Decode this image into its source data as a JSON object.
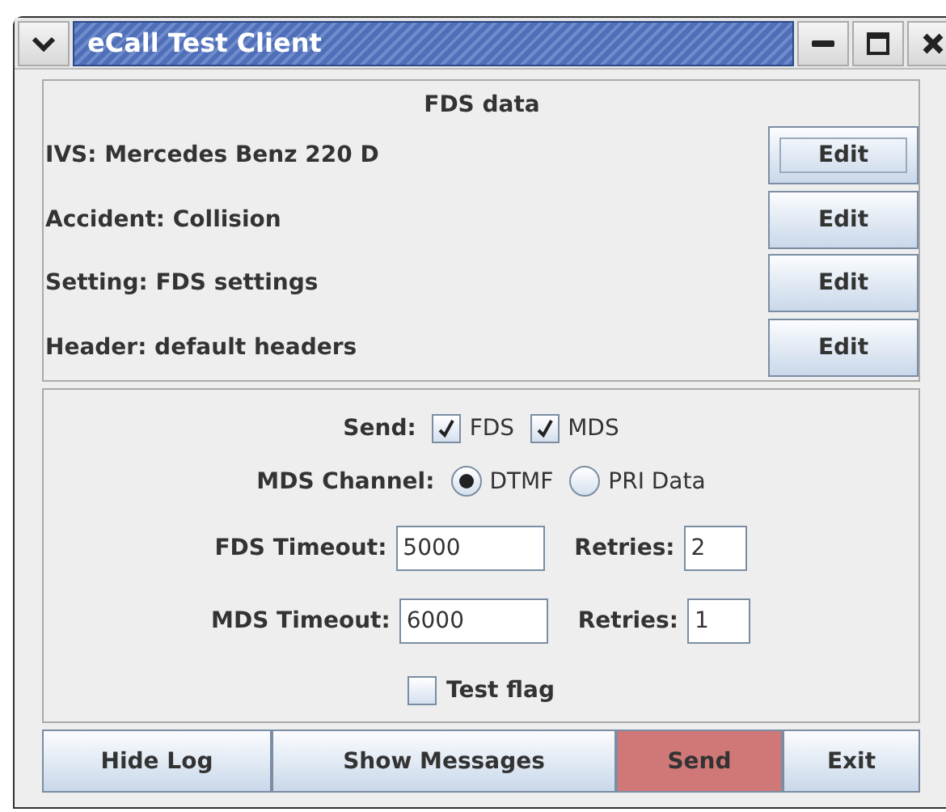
{
  "window": {
    "title": "eCall Test Client"
  },
  "fds_panel": {
    "title": "FDS data",
    "rows": [
      {
        "label": "IVS: Mercedes Benz 220 D",
        "button": "Edit",
        "focused": true
      },
      {
        "label": "Accident: Collision",
        "button": "Edit",
        "focused": false
      },
      {
        "label": "Setting: FDS settings",
        "button": "Edit",
        "focused": false
      },
      {
        "label": "Header: default headers",
        "button": "Edit",
        "focused": false
      }
    ]
  },
  "options_panel": {
    "send": {
      "label": "Send:",
      "options": [
        {
          "label": "FDS",
          "checked": true
        },
        {
          "label": "MDS",
          "checked": true
        }
      ]
    },
    "mds_channel": {
      "label": "MDS Channel:",
      "options": [
        {
          "label": "DTMF",
          "selected": true
        },
        {
          "label": "PRI Data",
          "selected": false
        }
      ]
    },
    "timeouts": [
      {
        "label": "FDS Timeout:",
        "value": "5000",
        "retries_label": "Retries:",
        "retries": "2"
      },
      {
        "label": "MDS Timeout:",
        "value": "6000",
        "retries_label": "Retries:",
        "retries": "1"
      }
    ],
    "test_flag": {
      "label": "Test flag",
      "checked": false
    }
  },
  "buttons": [
    {
      "label": "Hide Log",
      "highlighted": false
    },
    {
      "label": "Show Messages",
      "highlighted": false
    },
    {
      "label": "Send",
      "highlighted": true
    },
    {
      "label": "Exit",
      "highlighted": false
    }
  ]
}
